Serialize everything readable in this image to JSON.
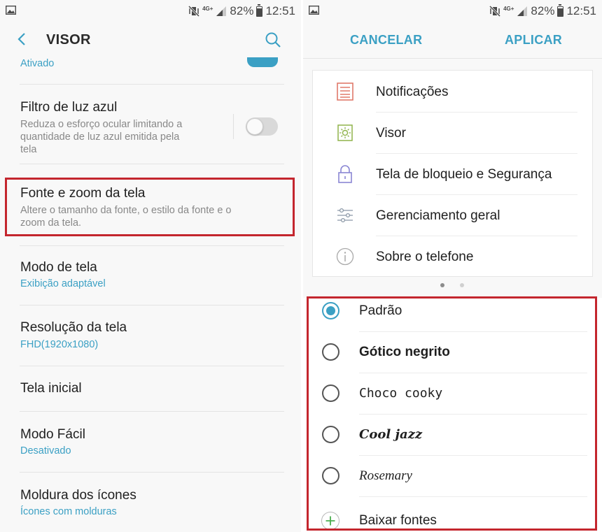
{
  "status_bar": {
    "battery": "82%",
    "time": "12:51",
    "network": "4G+"
  },
  "left": {
    "header": {
      "title": "VISOR"
    },
    "partial_item": {
      "subtitle": "Ativado"
    },
    "items": [
      {
        "title": "Filtro de luz azul",
        "description": "Reduza o esforço ocular limitando a quantidade de luz azul emitida pela tela",
        "toggle": "off"
      },
      {
        "title": "Fonte e zoom da tela",
        "description": "Altere o tamanho da fonte, o estilo da fonte e o zoom da tela."
      },
      {
        "title": "Modo de tela",
        "subtitle": "Exibição adaptável"
      },
      {
        "title": "Resolução da tela",
        "subtitle": "FHD(1920x1080)"
      },
      {
        "title": "Tela inicial"
      },
      {
        "title": "Modo Fácil",
        "subtitle": "Desativado"
      },
      {
        "title": "Moldura dos ícones",
        "subtitle": "Ícones com molduras"
      }
    ]
  },
  "right": {
    "buttons": {
      "cancel": "CANCELAR",
      "apply": "APLICAR"
    },
    "preview_items": [
      {
        "label": "Notificações",
        "icon": "notifications-icon"
      },
      {
        "label": "Visor",
        "icon": "display-icon"
      },
      {
        "label": "Tela de bloqueio e Segurança",
        "icon": "lock-icon"
      },
      {
        "label": "Gerenciamento geral",
        "icon": "sliders-icon"
      },
      {
        "label": "Sobre o telefone",
        "icon": "info-icon"
      }
    ],
    "fonts": [
      {
        "label": "Padrão",
        "selected": true
      },
      {
        "label": "Gótico negrito",
        "selected": false
      },
      {
        "label": "Choco cooky",
        "selected": false
      },
      {
        "label": "Cool jazz",
        "selected": false
      },
      {
        "label": "Rosemary",
        "selected": false
      }
    ],
    "download": {
      "label": "Baixar fontes"
    }
  },
  "colors": {
    "accent": "#3ba0c4",
    "highlight": "#c4262e",
    "green": "#4caf50"
  }
}
